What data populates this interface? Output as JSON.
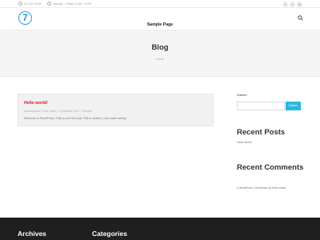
{
  "topbar": {
    "phone": "011 322 44 56",
    "hours": "Monday – Friday 10 AM – 8 PM",
    "social": [
      "f",
      "t",
      "◎"
    ]
  },
  "header": {
    "logo_text": "7",
    "nav_item": "Sample Page"
  },
  "page": {
    "title": "Blog",
    "breadcrumb": "Home"
  },
  "post": {
    "title": "Hello world!",
    "meta": "Uncategorized  ·  Door: admin  ·  3 november 2019  ·  1 Reactie",
    "excerpt": "Welcome to WordPress. This is your first post. Edit or delete it, then start writing!"
  },
  "sidebar": {
    "search_label": "Zoeken",
    "search_button": "Zoeken",
    "recent_posts_title": "Recent Posts",
    "recent_post": "Hello world!",
    "recent_comments_title": "Recent Comments",
    "recent_comment": "A WordPress Commenter bij Hello world!"
  },
  "footer": {
    "col1": "Archives",
    "col2": "Categories"
  },
  "colors": {
    "accent": "#2bb8e0",
    "post_title": "#d11e2b",
    "footer_bg": "#1f1f1f"
  }
}
